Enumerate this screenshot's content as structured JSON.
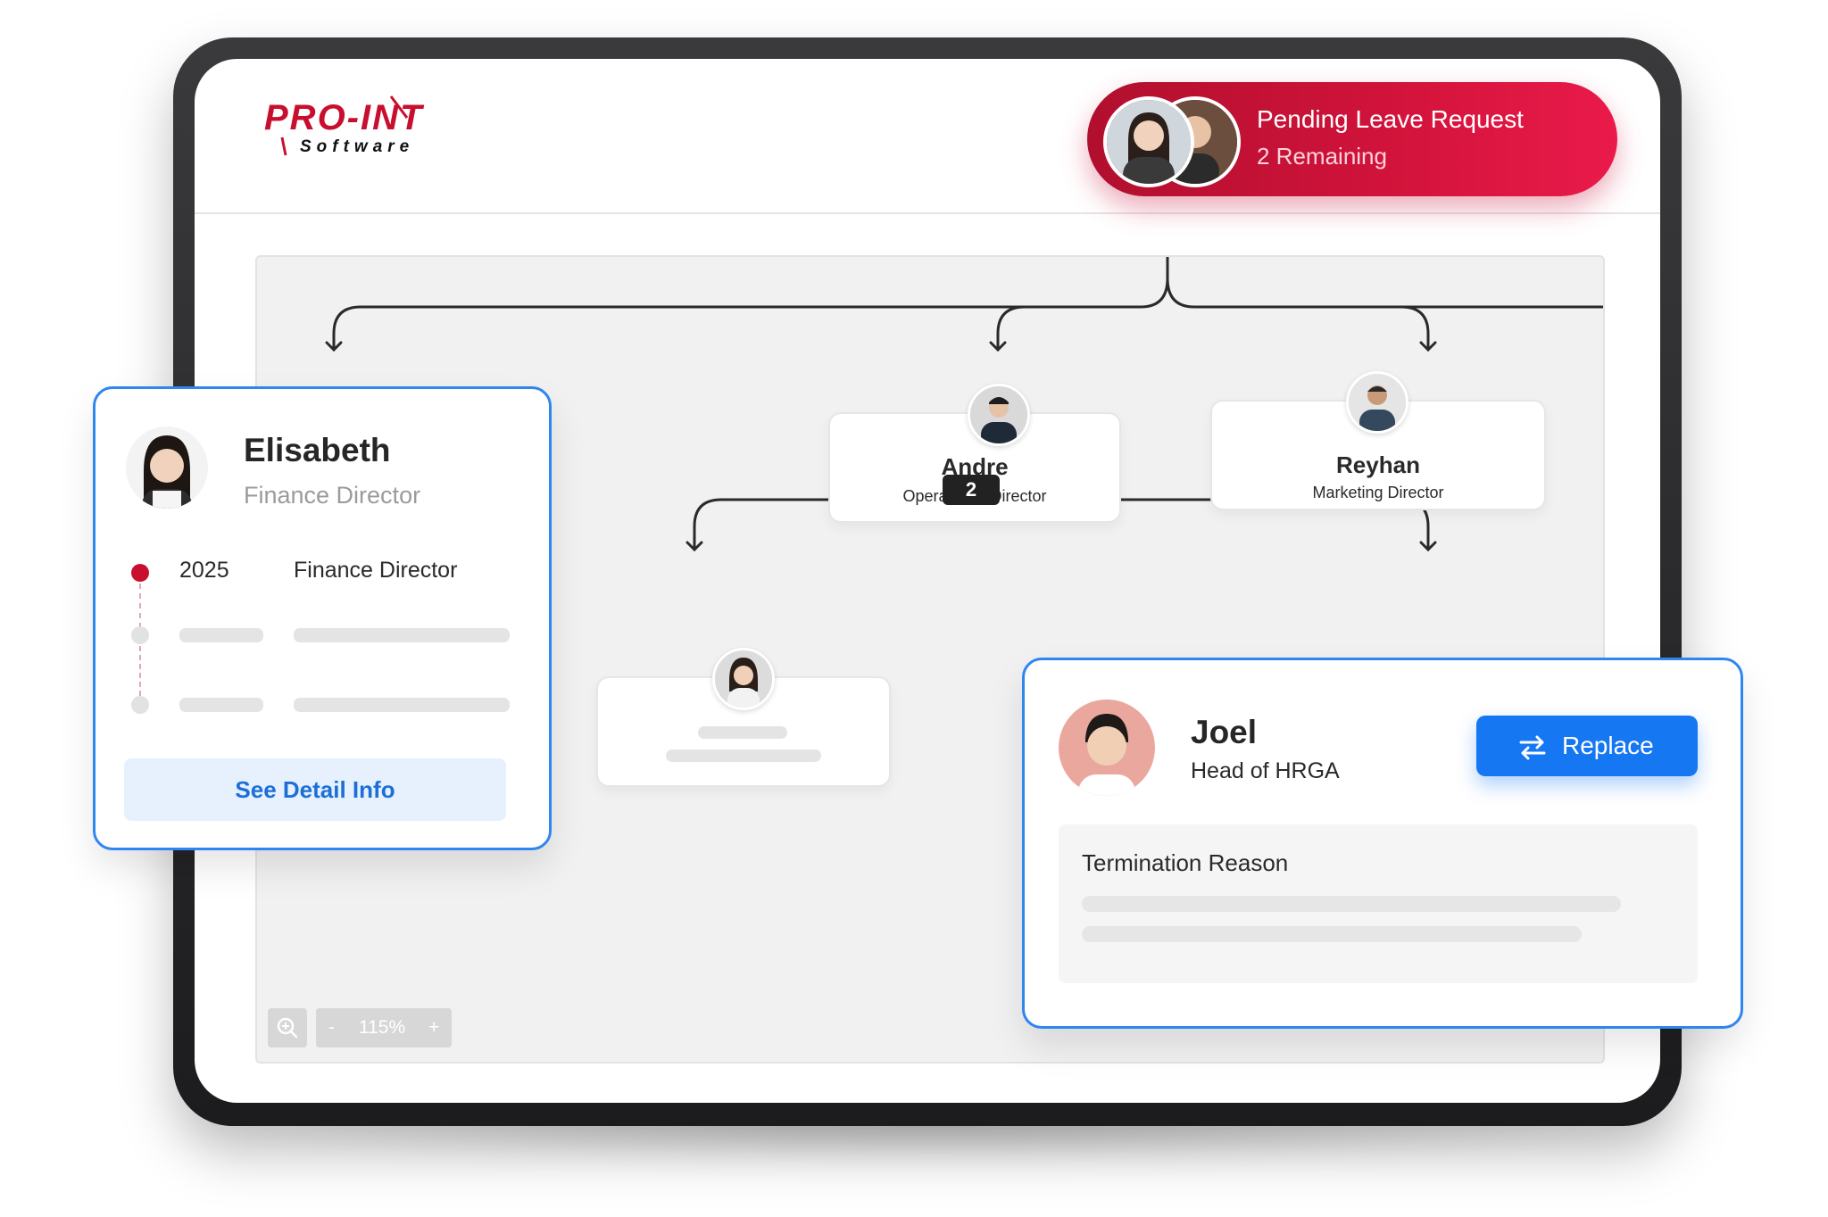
{
  "header": {
    "logo": {
      "brand": "PRO-INT",
      "sub": "Software"
    },
    "pending_request": {
      "title": "Pending Leave Request",
      "subtitle": "2 Remaining"
    }
  },
  "org_chart": {
    "nodes": [
      {
        "name": "Andre",
        "role": "Operational Director",
        "badge": "2"
      },
      {
        "name": "Reyhan",
        "role": "Marketing Director"
      }
    ],
    "zoom": {
      "minus": "-",
      "level": "115%",
      "plus": "+"
    }
  },
  "profile_card": {
    "name": "Elisabeth",
    "role": "Finance Director",
    "history": [
      {
        "year": "2025",
        "position": "Finance Director"
      }
    ],
    "button": "See Detail Info"
  },
  "replace_card": {
    "name": "Joel",
    "role": "Head of HRGA",
    "button": "Replace",
    "section_title": "Termination Reason"
  },
  "colors": {
    "brand_red": "#c8102e",
    "accent_blue": "#1677f2",
    "card_border": "#2f86f0"
  },
  "icons": [
    "zoom-in-icon",
    "swap-icon"
  ]
}
